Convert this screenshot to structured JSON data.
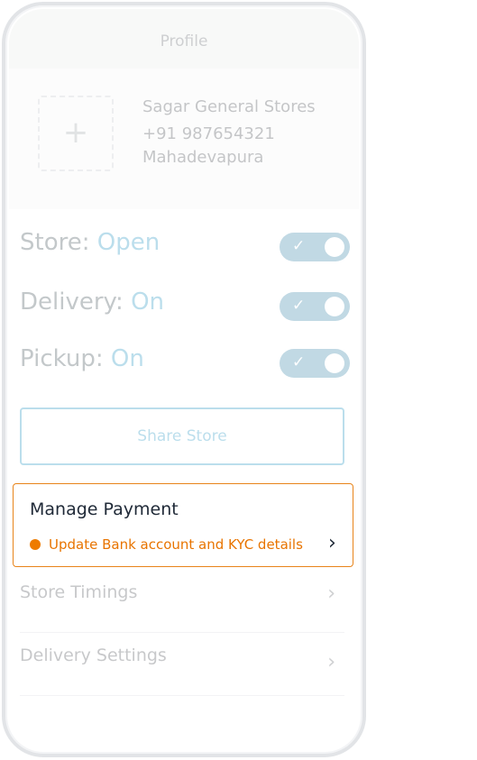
{
  "header": {
    "title": "Profile"
  },
  "store": {
    "name": "Sagar General Stores",
    "phone": "+91 987654321",
    "area": "Mahadevapura",
    "photo_icon": "plus-icon"
  },
  "status": [
    {
      "label": "Store:",
      "value": "Open",
      "enabled": true
    },
    {
      "label": "Delivery:",
      "value": "On",
      "enabled": true
    },
    {
      "label": "Pickup:",
      "value": "On",
      "enabled": true
    }
  ],
  "toggle_icon": "check-icon",
  "share_button": "Share Store",
  "payment": {
    "title": "Manage Payment",
    "subtitle": "Update Bank account and KYC details",
    "accent": "#ee7b00"
  },
  "menu": [
    {
      "label": "Store Timings"
    },
    {
      "label": "Delivery Settings"
    }
  ],
  "colors": {
    "brand": "#1b8fc0",
    "toggle": "#2f7fa4",
    "warning": "#ee7b00"
  }
}
